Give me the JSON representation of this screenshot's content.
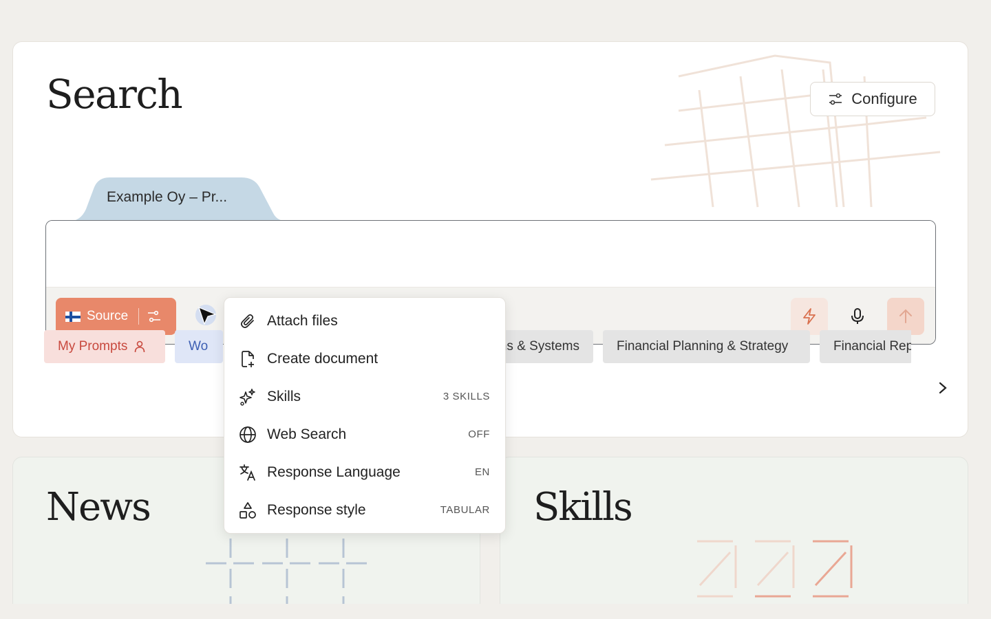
{
  "header": {
    "title": "Search",
    "configure_label": "Configure"
  },
  "composer": {
    "context_tab": "Example Oy – Pr...",
    "source_label": "Source"
  },
  "chips": {
    "my_prompts": "My Prompts",
    "wo": "Wo",
    "ons_systems": "ons & Systems",
    "financial_planning": "Financial Planning & Strategy",
    "financial_rep": "Financial Rep"
  },
  "menu": {
    "items": [
      {
        "label": "Attach files",
        "value": "",
        "icon": "paperclip-icon"
      },
      {
        "label": "Create document",
        "value": "",
        "icon": "file-plus-icon"
      },
      {
        "label": "Skills",
        "value": "3 SKILLS",
        "icon": "sparkles-icon"
      },
      {
        "label": "Web Search",
        "value": "OFF",
        "icon": "globe-icon"
      },
      {
        "label": "Response Language",
        "value": "EN",
        "icon": "translate-icon"
      },
      {
        "label": "Response style",
        "value": "TABULAR",
        "icon": "shapes-icon"
      }
    ]
  },
  "sections": {
    "news_title": "News",
    "skills_title": "Skills"
  },
  "colors": {
    "accent": "#e8886a",
    "tab": "#c5d8e5",
    "chip_red": "#f8dfdc",
    "chip_blue": "#dfe6f7"
  }
}
